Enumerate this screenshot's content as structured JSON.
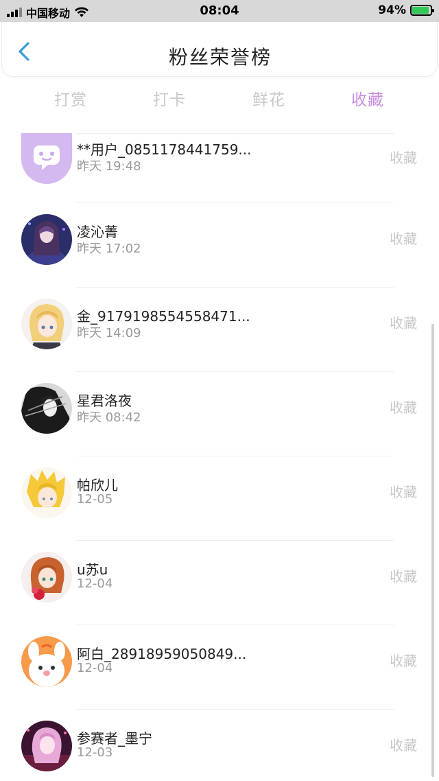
{
  "status_bar": {
    "carrier": "中国移动",
    "time": "08:04",
    "battery": "94%",
    "battery_level": 0.94
  },
  "header": {
    "title": "粉丝荣誉榜",
    "back_icon": "chevron-left-icon"
  },
  "tabs": [
    {
      "label": "打赏",
      "active": false
    },
    {
      "label": "打卡",
      "active": false
    },
    {
      "label": "鲜花",
      "active": false
    },
    {
      "label": "收藏",
      "active": true
    }
  ],
  "colors": {
    "accent": "#c58ce0",
    "back": "#3a9bdc",
    "inactive_tab": "#c9c9c9"
  },
  "fans": [
    {
      "name": "**用户_0851178441759...",
      "time": "昨天 19:48",
      "action": "收藏",
      "avatar": "purple-chat-avatar"
    },
    {
      "name": "凌沁菁",
      "time": "昨天 17:02",
      "action": "收藏",
      "avatar": "anime-girl-dark-avatar"
    },
    {
      "name": "金_9179198554558471...",
      "time": "昨天 14:09",
      "action": "收藏",
      "avatar": "anime-blonde-avatar"
    },
    {
      "name": "星君洛夜",
      "time": "昨天 08:42",
      "action": "收藏",
      "avatar": "anime-monochrome-avatar"
    },
    {
      "name": "帕欣儿",
      "time": "12-05",
      "action": "收藏",
      "avatar": "anime-yellow-hair-avatar"
    },
    {
      "name": "u苏u",
      "time": "12-04",
      "action": "收藏",
      "avatar": "anime-orange-hair-avatar"
    },
    {
      "name": "阿白_28918959050849...",
      "time": "12-04",
      "action": "收藏",
      "avatar": "cartoon-bunny-avatar"
    },
    {
      "name": "参赛者_墨宁",
      "time": "12-03",
      "action": "收藏",
      "avatar": "anime-pink-hair-avatar"
    }
  ]
}
